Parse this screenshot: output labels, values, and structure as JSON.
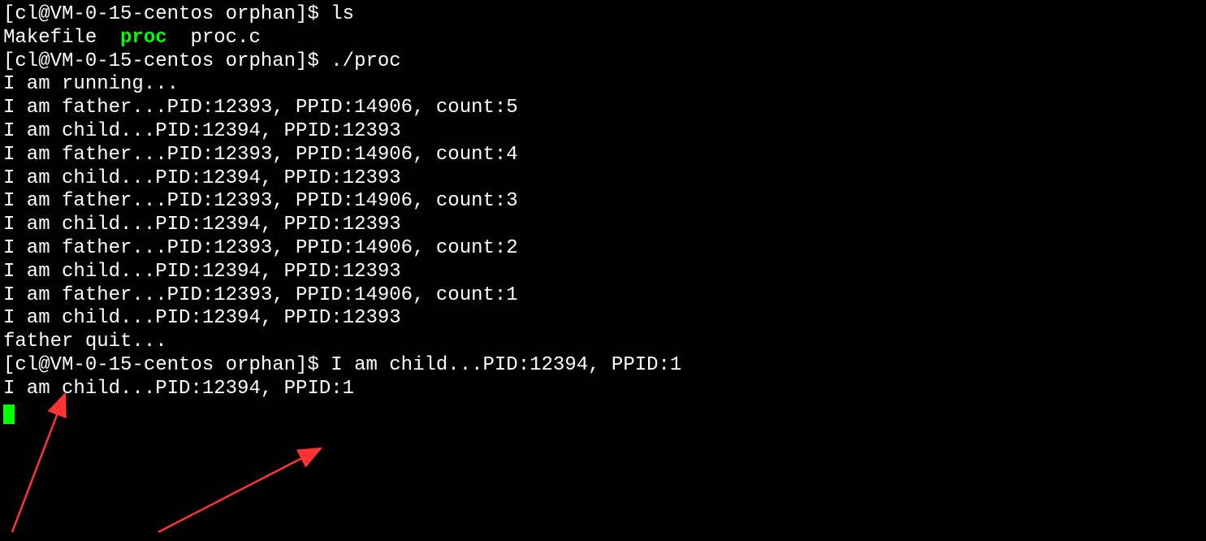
{
  "prompt": "[cl@VM-0-15-centos orphan]$ ",
  "commands": {
    "ls": "ls",
    "proc": "./proc"
  },
  "ls_output": {
    "file1": "Makefile  ",
    "executable": "proc",
    "file2": "  proc.c"
  },
  "lines": {
    "running": "I am running...",
    "father5": "I am father...PID:12393, PPID:14906, count:5",
    "child1": "I am child...PID:12394, PPID:12393",
    "father4": "I am father...PID:12393, PPID:14906, count:4",
    "child2": "I am child...PID:12394, PPID:12393",
    "father3": "I am father...PID:12393, PPID:14906, count:3",
    "child3": "I am child...PID:12394, PPID:12393",
    "father2": "I am father...PID:12393, PPID:14906, count:2",
    "child4": "I am child...PID:12394, PPID:12393",
    "father1": "I am father...PID:12393, PPID:14906, count:1",
    "child5": "I am child...PID:12394, PPID:12393",
    "fatherquit": "father quit...",
    "orphan1": "I am child...PID:12394, PPID:1",
    "orphan2": "I am child...PID:12394, PPID:1"
  }
}
